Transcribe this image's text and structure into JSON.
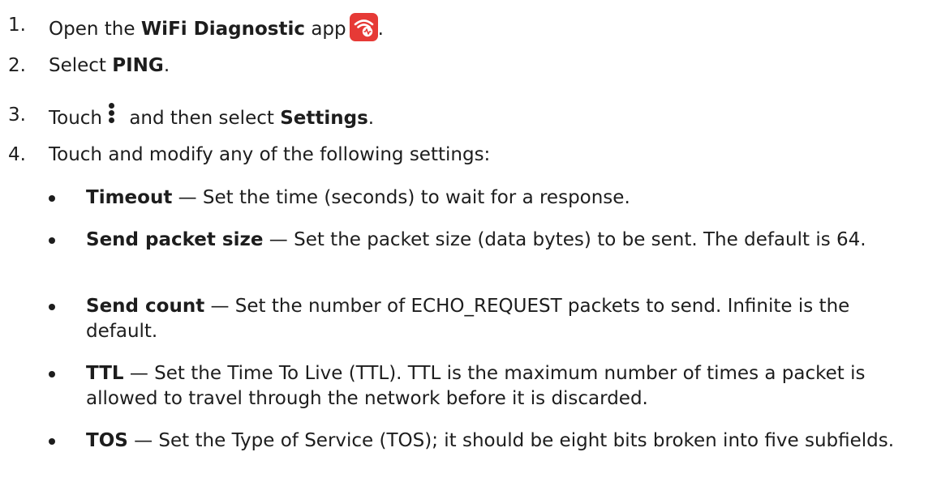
{
  "steps": [
    {
      "num": "1.",
      "pre": "Open the ",
      "bold": "WiFi Diagnostic",
      "post": " app",
      "end": "."
    },
    {
      "num": "2.",
      "pre": "Select ",
      "bold": "PING",
      "post": "."
    },
    {
      "num": "3.",
      "pre": "Touch",
      "mid": " and then select ",
      "bold": "Settings",
      "post": "."
    },
    {
      "num": "4.",
      "text": "Touch and modify any of the following settings:"
    }
  ],
  "bullets": [
    {
      "term": "Timeout",
      "desc": " — Set the time (seconds) to wait for a response."
    },
    {
      "term": "Send packet size",
      "desc": " — Set the packet size (data bytes) to be sent. The default is 64."
    },
    {
      "term": "Send count",
      "desc": " — Set the number of ECHO_REQUEST packets to send. Infinite is the default."
    },
    {
      "term": "TTL",
      "desc": " — Set the Time To Live (TTL). TTL is the maximum number of times a packet is allowed to travel through the network before it is discarded."
    },
    {
      "term": "TOS",
      "desc": " — Set the Type of Service (TOS); it should be eight bits broken into five subfields."
    }
  ],
  "icons": {
    "app_icon": "wifi-diagnostic-app-icon",
    "menu_icon": "more-vert-icon",
    "app_icon_color": "#e63a36"
  }
}
